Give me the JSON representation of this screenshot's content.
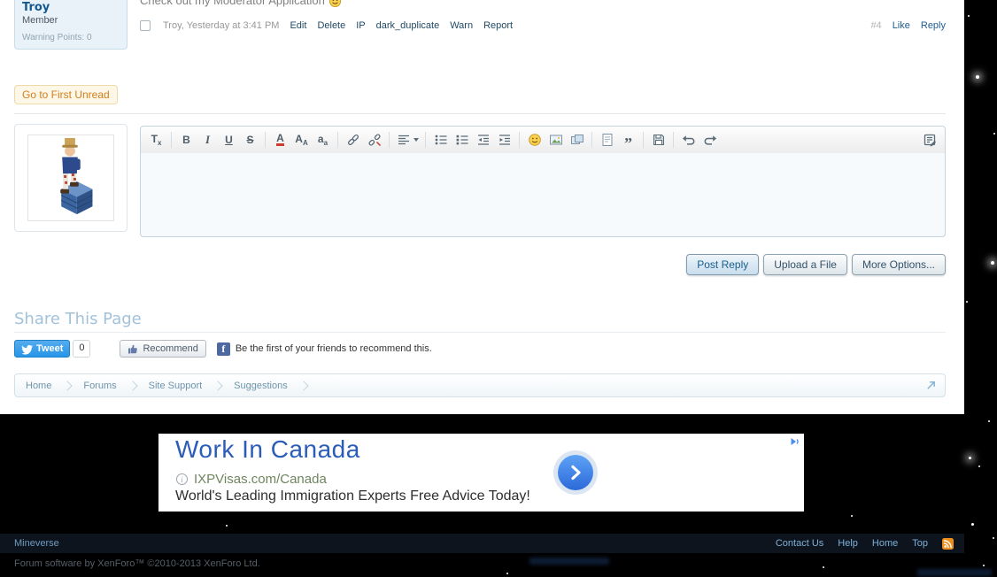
{
  "post": {
    "author": {
      "name": "Troy",
      "user_title": "Member",
      "warning_points_label": "Warning Points:",
      "warning_points_value": "0"
    },
    "message_text": "Check out my Moderator Application",
    "date_line": "Troy, Yesterday at 3:41 PM",
    "mod_links": [
      "Edit",
      "Delete",
      "IP",
      "dark_duplicate",
      "Warn",
      "Report"
    ],
    "post_number": "#4",
    "action_links": [
      "Like",
      "Reply"
    ]
  },
  "thread": {
    "go_to_first_unread": "Go to First Unread"
  },
  "editor": {
    "glyphs": {
      "t": "T",
      "x": "x",
      "bold": "B",
      "italic": "I",
      "underline": "U",
      "strike": "S",
      "color_a": "A",
      "size_a": "A",
      "size_a_small": "A",
      "family_a": "a",
      "family_a_small": "a",
      "quote": "”"
    }
  },
  "reply_actions": {
    "post_reply": "Post Reply",
    "upload_file": "Upload a File",
    "more_options": "More Options..."
  },
  "share": {
    "heading": "Share This Page",
    "tweet_label": "Tweet",
    "tweet_count": "0",
    "recommend_label": "Recommend",
    "facebook_glyph": "f",
    "facebook_text": "Be the first of your friends to recommend this."
  },
  "breadcrumb": {
    "items": [
      "Home",
      "Forums",
      "Site Support",
      "Suggestions"
    ]
  },
  "ad": {
    "headline": "Work In Canada",
    "info_glyph": "i",
    "display_url": "IXPVisas.com/Canada",
    "tagline": "World's Leading Immigration Experts Free Advice Today!"
  },
  "footer": {
    "brand": "Mineverse",
    "links": [
      "Contact Us",
      "Help",
      "Home",
      "Top"
    ],
    "copyright": "Forum software by XenForo™ ©2010-2013 XenForo Ltd."
  },
  "icons": {
    "smiley": "yellow-smile-face",
    "twitter_bird": "bird",
    "facebook_thumb": "thumbs-up",
    "rss": "orange-rss-square",
    "jump_arrow": "up-right-arrow",
    "adchoices": "blue-play-triangle"
  },
  "colors": {
    "link_blue": "#176093",
    "pale_heading_blue": "#a2c2da",
    "unread_orange": "#d07f1f",
    "footer_bg": "#0d141d",
    "twitter_blue": "#2795e9",
    "facebook_blue": "#4e69a2",
    "rss_orange": "#ec8e1c",
    "ad_headline_blue": "#2b5cb8",
    "ad_url_green": "#70855e"
  }
}
